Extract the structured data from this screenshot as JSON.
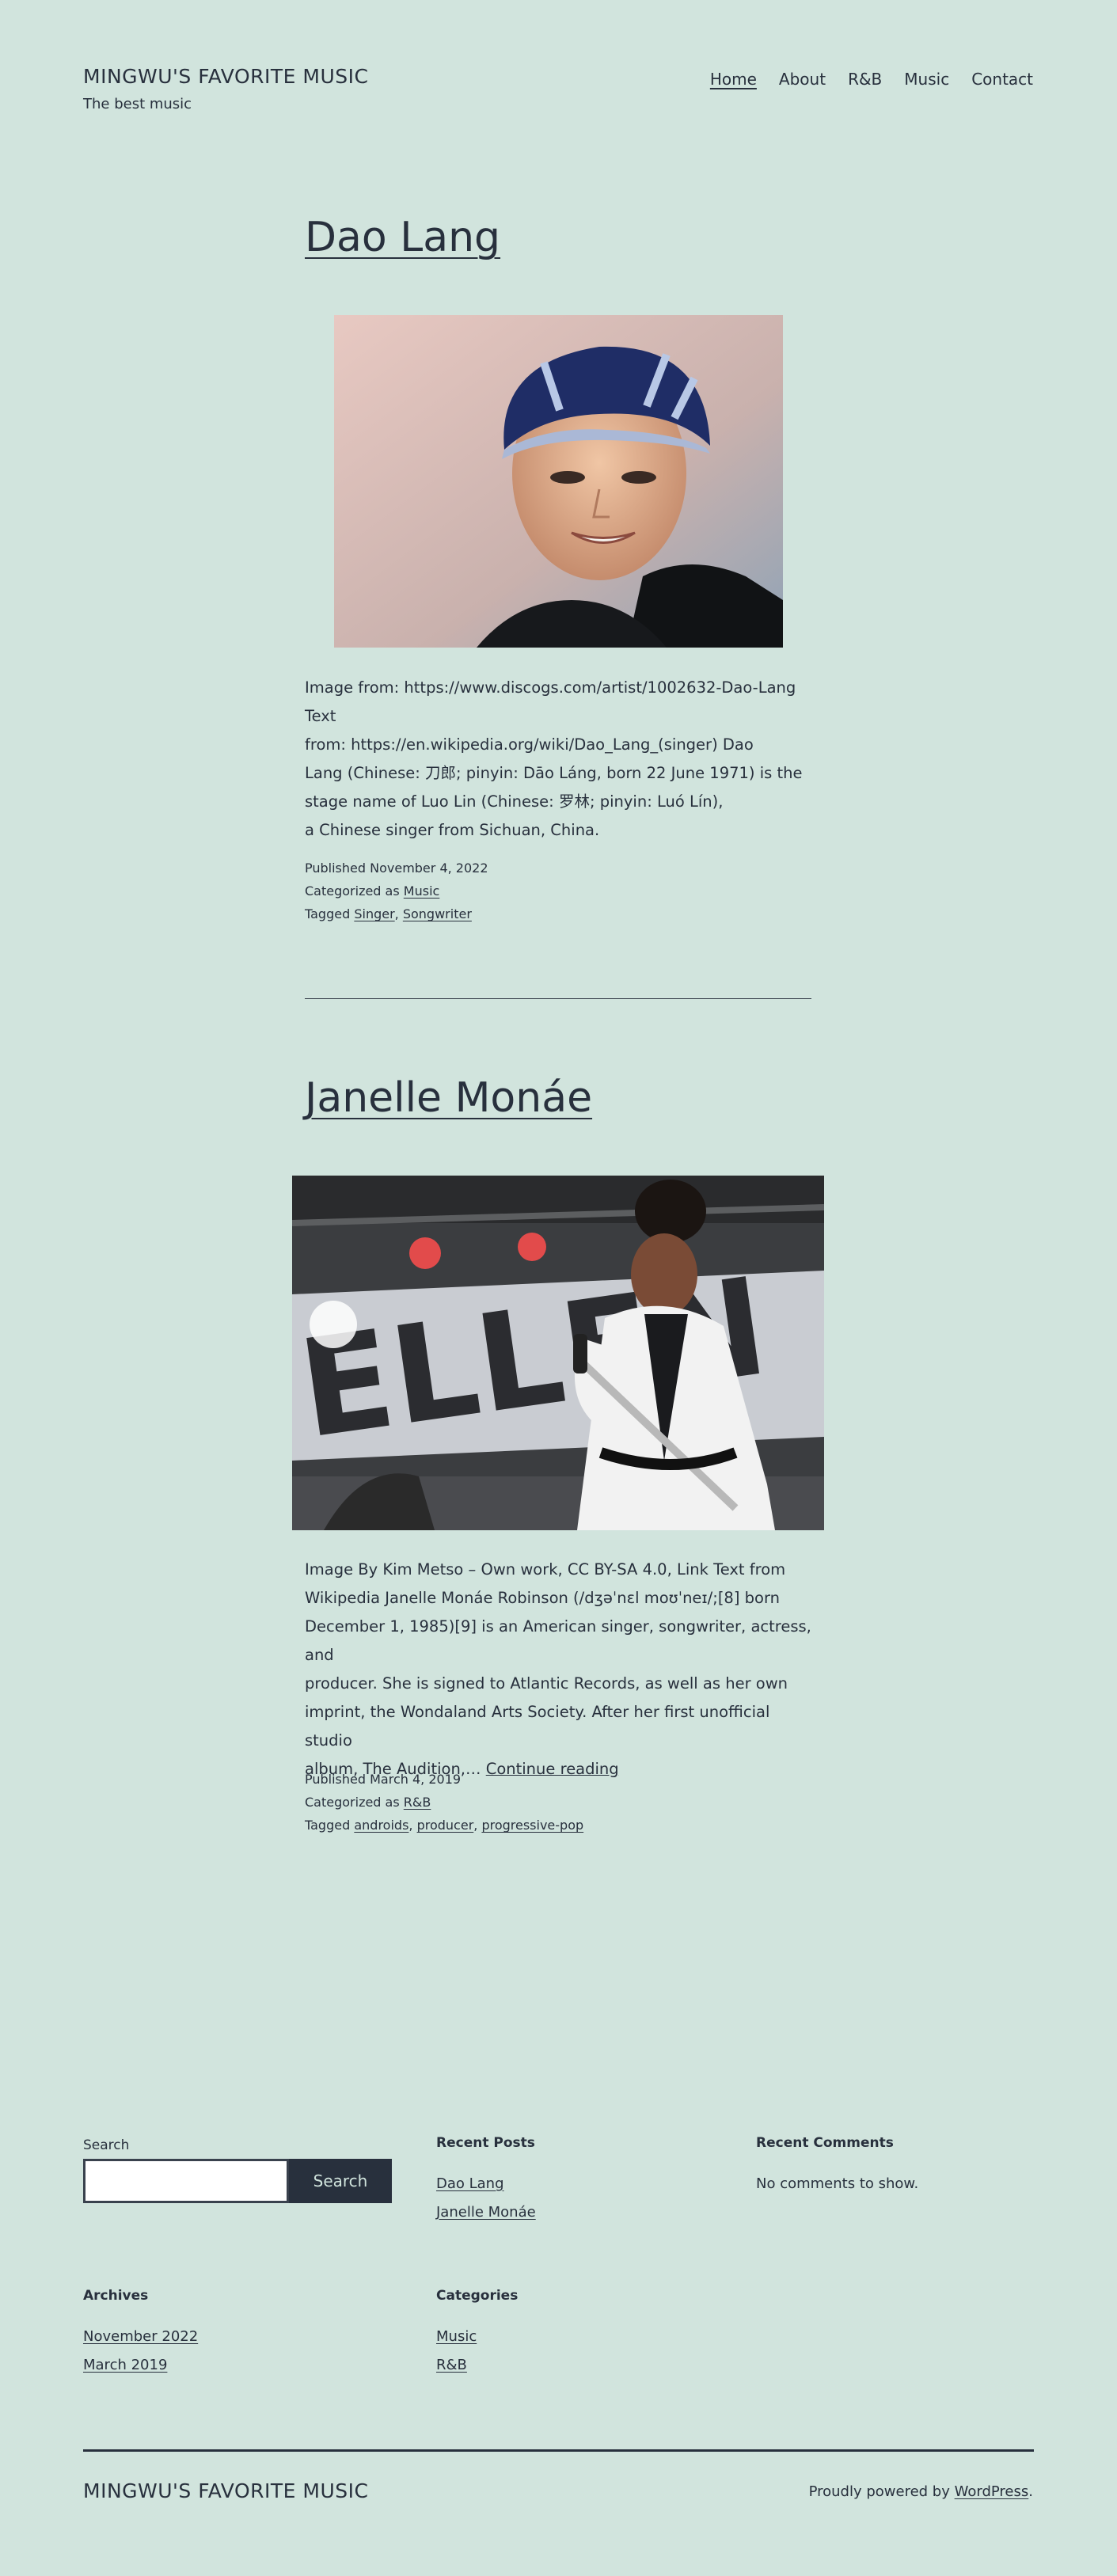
{
  "site": {
    "title": "MINGWU'S FAVORITE MUSIC",
    "description": "The best music"
  },
  "nav": {
    "items": [
      "Home",
      "About",
      "R&B",
      "Music",
      "Contact"
    ],
    "current": "Home"
  },
  "posts": [
    {
      "title": "Dao Lang",
      "excerpt_lines": [
        "Image from: https://www.discogs.com/artist/1002632-Dao-Lang Text",
        "from: https://en.wikipedia.org/wiki/Dao_Lang_(singer) Dao",
        "Lang (Chinese: 刀郎; pinyin: Dāo Láng, born 22 June 1971) is the",
        "stage name of Luo Lin (Chinese: 罗林; pinyin: Luó Lín),",
        "a Chinese singer from Sichuan, China."
      ],
      "published_label": "Published November 4, 2022",
      "categorized_label": "Categorized as",
      "category": "Music",
      "tagged_label": "Tagged",
      "tags": [
        "Singer",
        "Songwriter"
      ]
    },
    {
      "title": "Janelle Monáe",
      "excerpt_lines": [
        "Image By Kim Metso – Own work, CC BY-SA 4.0, Link Text from",
        "Wikipedia Janelle Monáe Robinson (/dʒəˈnɛl moʊˈneɪ/;[8] born",
        "December 1, 1985)[9] is an American singer, songwriter, actress, and",
        "producer. She is signed to Atlantic Records, as well as her own",
        "imprint, the Wondaland Arts Society. After her first unofficial studio",
        "album, The Audition,…"
      ],
      "continue_reading": "Continue reading",
      "published_label": "Published March 4, 2019",
      "categorized_label": "Categorized as",
      "category": "R&B",
      "tagged_label": "Tagged",
      "tags": [
        "androids",
        "producer",
        "progressive-pop"
      ]
    }
  ],
  "footer": {
    "search": {
      "label": "Search",
      "button": "Search",
      "value": ""
    },
    "recent_posts": {
      "title": "Recent Posts",
      "items": [
        "Dao Lang",
        "Janelle Monáe"
      ]
    },
    "recent_comments": {
      "title": "Recent Comments",
      "empty": "No comments to show."
    },
    "archives": {
      "title": "Archives",
      "items": [
        "November 2022",
        "March 2019"
      ]
    },
    "categories": {
      "title": "Categories",
      "items": [
        "Music",
        "R&B"
      ]
    },
    "site_title": "MINGWU'S FAVORITE MUSIC",
    "powered_prefix": "Proudly powered by",
    "powered_link": "WordPress",
    "powered_suffix": "."
  },
  "colors": {
    "background": "#d1e4dd",
    "text": "#28303d"
  },
  "icons": {
    "post_image_1": "portrait-photo-icon",
    "post_image_2": "concert-photo-icon"
  }
}
